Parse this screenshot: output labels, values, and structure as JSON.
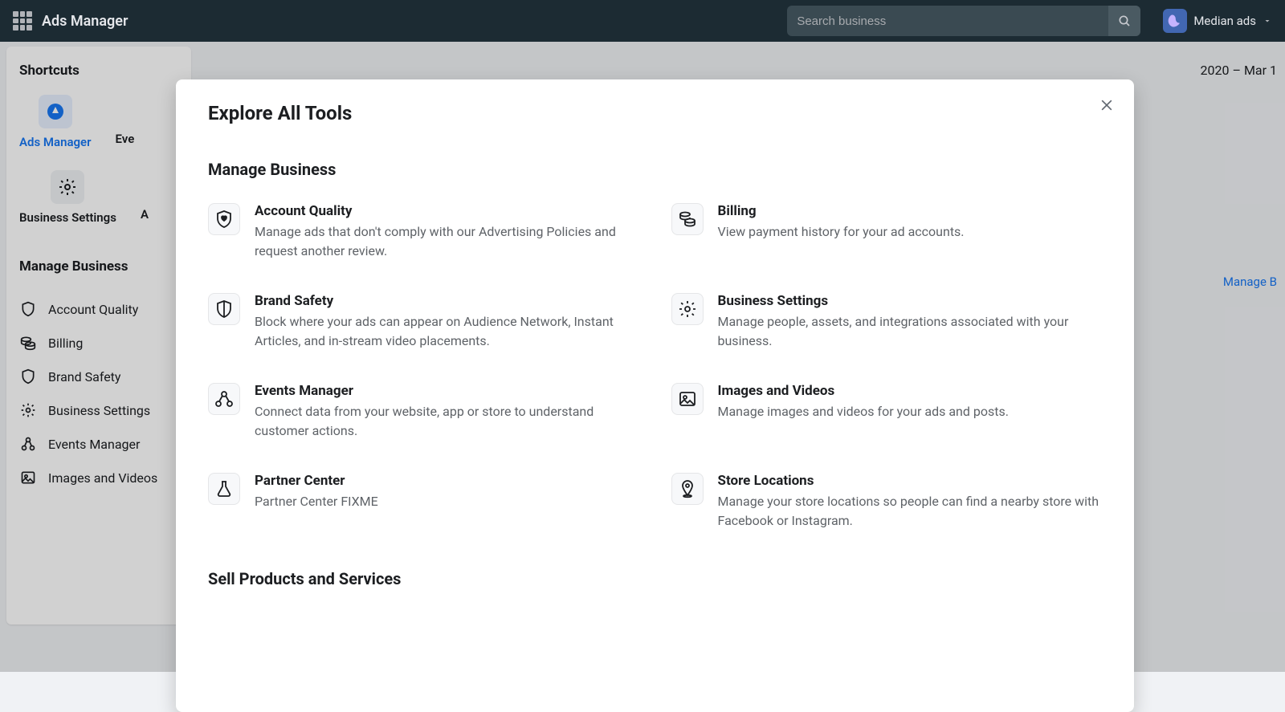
{
  "topbar": {
    "title": "Ads Manager",
    "search_placeholder": "Search business",
    "account_name": "Median ads"
  },
  "sidebar": {
    "shortcuts_header": "Shortcuts",
    "shortcuts": [
      {
        "label": "Ads Manager",
        "active": true
      },
      {
        "label": "Eve"
      },
      {
        "label": "Business Settings"
      },
      {
        "label": "A"
      }
    ],
    "manage_header": "Manage Business",
    "items": [
      {
        "label": "Account Quality"
      },
      {
        "label": "Billing"
      },
      {
        "label": "Brand Safety"
      },
      {
        "label": "Business Settings"
      },
      {
        "label": "Events Manager"
      },
      {
        "label": "Images and Videos"
      }
    ]
  },
  "bg": {
    "date_range": "2020 – Mar 1",
    "manage_link": "Manage B"
  },
  "modal": {
    "title": "Explore All Tools",
    "section1": "Manage Business",
    "section2": "Sell Products and Services",
    "tools": [
      {
        "title": "Account Quality",
        "desc": "Manage ads that don't comply with our Advertising Policies and request another review.",
        "icon": "shield-heart"
      },
      {
        "title": "Billing",
        "desc": "View payment history for your ad accounts.",
        "icon": "coins"
      },
      {
        "title": "Brand Safety",
        "desc": "Block where your ads can appear on Audience Network, Instant Articles, and in-stream video placements.",
        "icon": "shield"
      },
      {
        "title": "Business Settings",
        "desc": "Manage people, assets, and integrations associated with your business.",
        "icon": "gear"
      },
      {
        "title": "Events Manager",
        "desc": "Connect data from your website, app or store to understand customer actions.",
        "icon": "nodes"
      },
      {
        "title": "Images and Videos",
        "desc": "Manage images and videos for your ads and posts.",
        "icon": "image"
      },
      {
        "title": "Partner Center",
        "desc": "Partner Center FIXME",
        "icon": "flask"
      },
      {
        "title": "Store Locations",
        "desc": "Manage your store locations so people can find a nearby store with Facebook or Instagram.",
        "icon": "pin"
      }
    ]
  }
}
